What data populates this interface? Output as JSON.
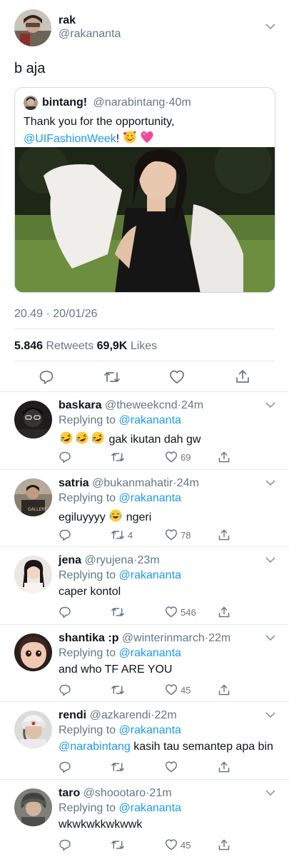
{
  "main_tweet": {
    "display_name": "rak",
    "handle": "@rakananta",
    "text": "b aja",
    "quoted": {
      "display_name": "bintang!",
      "handle": "@narabintang",
      "sep": "·",
      "time": "40m",
      "text_line1": "Thank you for the opportunity,",
      "mention": "@UIFashionWeek",
      "text_after_mention": "!"
    },
    "timestamp": "20.49 · 20/01/26",
    "retweets_count": "5.846",
    "retweets_label": "Retweets",
    "likes_count": "69,9K",
    "likes_label": "Likes"
  },
  "replying_label": "Replying to",
  "replying_handle": "@rakananta",
  "replies": [
    {
      "display_name": "baskara",
      "handle": "@theweekcnd",
      "time": "24m",
      "text": "gak ikutan dah gw",
      "retweets": "",
      "likes": "69"
    },
    {
      "display_name": "satria",
      "handle": "@bukanmahatir",
      "time": "24m",
      "text_before": "egiluyyyy",
      "text_after": "ngeri",
      "retweets": "4",
      "likes": "78"
    },
    {
      "display_name": "jena",
      "handle": "@ryujena",
      "time": "23m",
      "text": "caper kontol",
      "retweets": "",
      "likes": "546"
    },
    {
      "display_name": "shantika :p",
      "handle": "@winterinmarch",
      "time": "22m",
      "text": "and who TF ARE YOU",
      "retweets": "",
      "likes": "45"
    },
    {
      "display_name": "rendi",
      "handle": "@azkarendi",
      "time": "22m",
      "mention": "@narabintang",
      "text": "kasih tau semantep apa bin",
      "retweets": "",
      "likes": ""
    },
    {
      "display_name": "taro",
      "handle": "@shoootaro",
      "time": "21m",
      "text": "wkwkwkkwkwwk",
      "retweets": "",
      "likes": "45"
    }
  ],
  "colors": {
    "link": "#1d9bf0",
    "secondary": "#657786",
    "divider": "#e1e8ed"
  }
}
